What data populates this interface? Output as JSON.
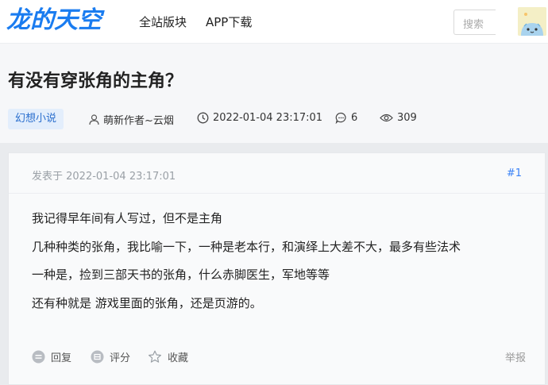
{
  "header": {
    "logo": "龙的天空",
    "nav": [
      "全站版块",
      "APP下载"
    ],
    "search_placeholder": "搜索"
  },
  "post": {
    "title": "有没有穿张角的主角？",
    "tag": "幻想小说",
    "author": "萌新作者~云烟",
    "datetime": "2022-01-04 23:17:01",
    "reply_count": "6",
    "view_count": "309"
  },
  "floor_post": {
    "posted_at": "发表于 2022-01-04 23:17:01",
    "floor": "#1",
    "lines": [
      "我记得早年间有人写过，但不是主角",
      "几种种类的张角，我比喻一下，一种是老本行，和演绎上大差不大，最多有些法术",
      "一种是，捡到三部天书的张角，什么赤脚医生，军地等等",
      "还有种就是 游戏里面的张角，还是页游的。"
    ],
    "actions": {
      "reply": "回复",
      "rate": "评分",
      "favorite": "收藏",
      "report": "举报"
    }
  },
  "colors": {
    "brand": "#1a7cf0",
    "tag_bg": "#e3eefc",
    "tag_text": "#2b6fce",
    "link": "#3b82f6"
  }
}
